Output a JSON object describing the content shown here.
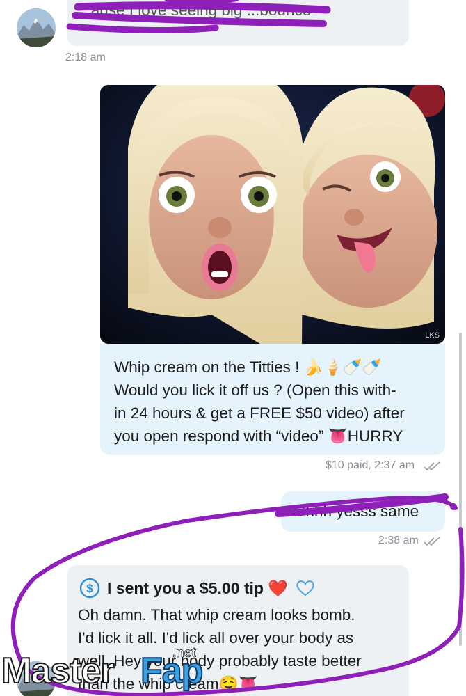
{
  "messages": [
    {
      "id": "incoming-1",
      "direction": "incoming",
      "text": "...ause I love seeing big ...bounce",
      "timestamp": "2:18 am"
    },
    {
      "id": "outgoing-media",
      "direction": "outgoing",
      "media_label": "LKS",
      "lines": [
        "Whip cream on the Titties ! 🍌🍦🍼🍼",
        "Would you lick it off us ? (Open this with-",
        "in 24 hours & get a FREE $50 video) after",
        "you open respond with “video” 👅HURRY"
      ],
      "paid_label": "$10 paid, 2:37 am"
    },
    {
      "id": "outgoing-2",
      "direction": "outgoing",
      "text": "Ohhh yesss same",
      "timestamp": "2:38 am"
    },
    {
      "id": "incoming-tip",
      "direction": "incoming",
      "tip_label": "I sent you a $5.00 tip ❤️",
      "lines": [
        "Oh damn. That whip cream looks bomb.",
        "I'd lick it all. I'd lick all over your body as",
        "well. Hey your body probably taste better",
        "than the whip cream🤤👅"
      ]
    }
  ],
  "watermark": {
    "master": "Master",
    "fap": "Fap",
    "net": ".net"
  },
  "colors": {
    "incoming_bubble": "#eef1f4",
    "outgoing_bubble": "#e5f3fc",
    "timestamp": "#8a8f98",
    "scribble": "#8e1fb8",
    "tip_icon": "#2b8fd6",
    "heart": "#d3202a"
  },
  "icons": [
    "avatar",
    "double-check-icon",
    "dollar-circle-icon",
    "heart-icon",
    "outline-heart-icon"
  ]
}
